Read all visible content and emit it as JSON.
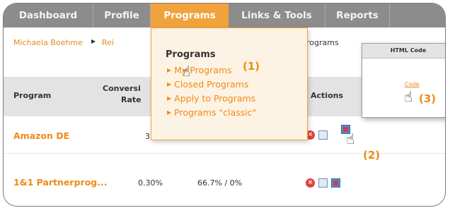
{
  "nav": {
    "items": [
      {
        "label": "Dashboard"
      },
      {
        "label": "Profile"
      },
      {
        "label": "Programs"
      },
      {
        "label": "Links & Tools"
      },
      {
        "label": "Reports"
      }
    ]
  },
  "breadcrumb": {
    "user": "Michaela Boehme",
    "partial": "Rei",
    "current": "rograms"
  },
  "table": {
    "headers": {
      "program": "Program",
      "conversion_line1": "Conversi",
      "conversion_line2": "Rate",
      "actions": "Actions"
    },
    "rows": [
      {
        "program": "Amazon DE",
        "conversion": "3."
      },
      {
        "program": "1&1 Partnerprog...",
        "conversion": "0.30%",
        "ratio": "66.7% / 0%"
      }
    ]
  },
  "dropdown": {
    "title": "Programs",
    "items": [
      {
        "label": "My Programs"
      },
      {
        "label": "Closed Programs"
      },
      {
        "label": "Apply to Programs"
      },
      {
        "label": "Programs \"classic\""
      }
    ]
  },
  "popup": {
    "title": "HTML Code",
    "link": "Code"
  },
  "annotations": {
    "a1": "(1)",
    "a2": "(2)",
    "a3": "(3)"
  },
  "colors": {
    "accent": "#f2a23c",
    "link": "#f08a16",
    "nav_bg": "#8c8c8c"
  }
}
